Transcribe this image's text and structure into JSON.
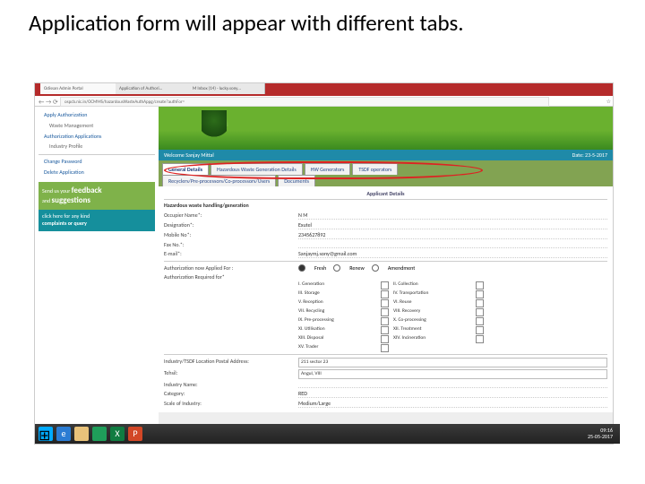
{
  "slide": {
    "title": "Application form will appear with different tabs."
  },
  "browser": {
    "tabs": [
      "Odissan Admin Portal",
      "Application of Authori…",
      "M  Inbox  (14) - lucky.sony…"
    ],
    "url": "ospcb.nic.in/OCMMS/hazardousWasteAuthAppg/create?authFor="
  },
  "sidebar": {
    "items": [
      "Apply Authorization",
      "Waste Management",
      "Authorization Applications",
      "Industry Profile"
    ],
    "footer": [
      "Change Password",
      "Delete Application"
    ]
  },
  "feedback": {
    "line1": "Send us your",
    "line2": "feedback",
    "line3": "and",
    "line4": "suggestions"
  },
  "complaints": {
    "line1": "click here for any kind",
    "line2": "complaints or query"
  },
  "welcome": {
    "left": "Welcome Sanjay Mittal",
    "right": "Date: 23-5-2017"
  },
  "tabs": {
    "row1": [
      "General Details",
      "Hazardous Waste Generation Details",
      "HW Generators",
      "TSDF operators"
    ],
    "row2": [
      "Recyclers/Pre-processors/Co-processors/Users",
      "Documents"
    ]
  },
  "section": {
    "title": "Hazardous waste handling/generation",
    "applicant": "Applicant Details"
  },
  "fields": {
    "occupier_lbl": "Occupier Name*:",
    "occupier": "N M",
    "designation_lbl": "Designation*:",
    "designation": "Exutel",
    "mobile_lbl": "Mobile No*:",
    "mobile": "2345627892",
    "fax_lbl": "Fax No.*:",
    "fax": "",
    "email_lbl": "E-mail*:",
    "email": "Sanjaymj.sony@gmail.com",
    "auth_lbl": "Authorization now Applied For :",
    "auth_opts": {
      "a": "Fresh",
      "b": "Renew",
      "c": "Amendment"
    },
    "req_lbl": "Authorization Required for*",
    "checks": [
      [
        "I.",
        "Generation",
        "II.",
        "Collection"
      ],
      [
        "III.",
        "Storage",
        "IV.",
        "Transportation"
      ],
      [
        "V.",
        "Reception",
        "VI.",
        "Reuse"
      ],
      [
        "VII.",
        "Recycling",
        "VIII.",
        "Recovery"
      ],
      [
        "IX.",
        "Pre-processing",
        "X.",
        "Co-processing"
      ],
      [
        "XI.",
        "Utilisation",
        "XII.",
        "Treatment"
      ],
      [
        "XIII.",
        "Disposal",
        "XIV.",
        "Incineration"
      ],
      [
        "XV.",
        "Trader",
        "",
        ""
      ]
    ],
    "postal_lbl": "Industry/TSDF Location Postal Address:",
    "postal": "211 sector 23",
    "tehsil_lbl": "Tehsil:",
    "tehsil": "Angul, VIII",
    "indname_lbl": "Industry Name:",
    "indname": "",
    "category_lbl": "Category:",
    "category": "RED",
    "scale_lbl": "Scale of Industry:",
    "scale": "Medium/Large"
  },
  "icons": {
    "win": "⊞",
    "ie": "e",
    "folder": "▣",
    "store": "▤",
    "excel": "X",
    "ppt": "P"
  },
  "clock": {
    "time": "09:16",
    "date": "25-05-2017"
  }
}
